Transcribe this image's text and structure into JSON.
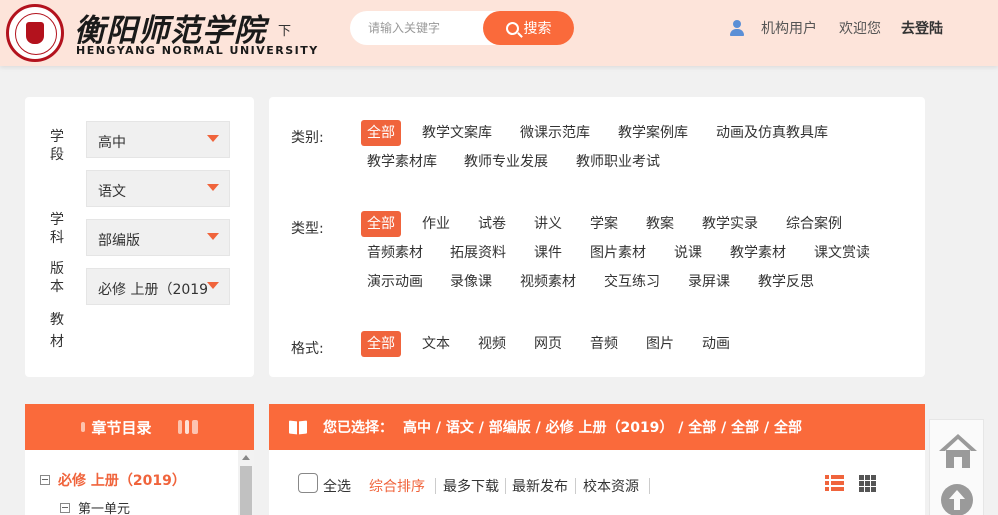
{
  "header": {
    "logo_cn": "衡阳师范学院",
    "logo_cn_tail": "下",
    "logo_en": "HENGYANG NORMAL UNIVERSITY",
    "search_placeholder": "请输入关键字",
    "search_button": "搜索",
    "user_label": "机构用户",
    "welcome": "欢迎您",
    "login": "去登陆"
  },
  "filters": {
    "left": [
      {
        "label": "学段",
        "value": "高中"
      },
      {
        "label": "学科",
        "value": "语文"
      },
      {
        "label": "版本",
        "value": "部编版"
      },
      {
        "label": "教材",
        "value": "必修 上册（2019）"
      }
    ],
    "category": {
      "label": "类别:",
      "options": [
        "全部",
        "教学文案库",
        "微课示范库",
        "教学案例库",
        "动画及仿真教具库",
        "教学素材库",
        "教师专业发展",
        "教师职业考试"
      ]
    },
    "type": {
      "label": "类型:",
      "options": [
        "全部",
        "作业",
        "试卷",
        "讲义",
        "学案",
        "教案",
        "教学实录",
        "综合案例",
        "音频素材",
        "拓展资料",
        "课件",
        "图片素材",
        "说课",
        "教学素材",
        "课文赏读",
        "演示动画",
        "录像课",
        "视频素材",
        "交互练习",
        "录屏课",
        "教学反思"
      ]
    },
    "format": {
      "label": "格式:",
      "options": [
        "全部",
        "文本",
        "视频",
        "网页",
        "音频",
        "图片",
        "动画"
      ]
    }
  },
  "chapter": {
    "title": "章节目录",
    "items": [
      {
        "label": "必修 上册（2019）"
      },
      {
        "label": "第一单元"
      }
    ]
  },
  "result": {
    "selected_label": "您已选择：",
    "selected_value": "高中 / 语文 / 部编版 / 必修 上册（2019） / 全部 / 全部 / 全部",
    "select_all": "全选",
    "sorts": [
      "综合排序",
      "最多下载",
      "最新发布",
      "校本资源"
    ]
  },
  "colors": {
    "accent": "#fa6a3b",
    "header_bg": "#fde4da",
    "seal": "#b3121d"
  }
}
